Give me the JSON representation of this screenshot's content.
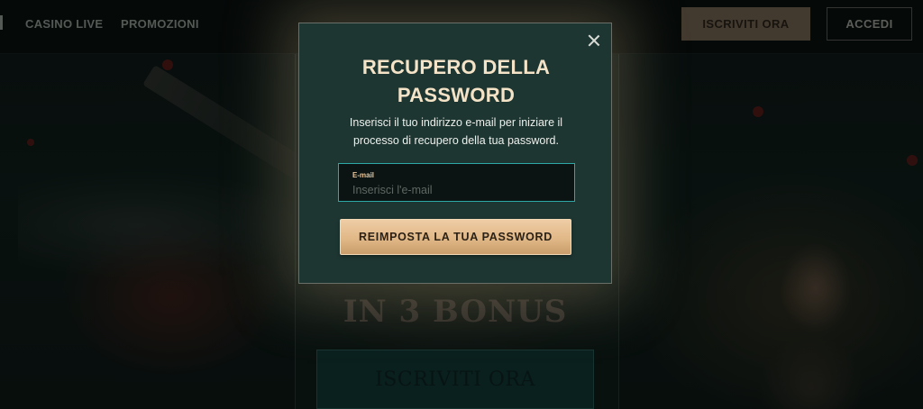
{
  "nav": {
    "links": [
      "CASINO LIVE",
      "PROMOZIONI"
    ],
    "signup_label": "ISCRIVITI ORA",
    "login_label": "ACCEDI"
  },
  "hero": {
    "title": "IN 3 BONUS",
    "cta_label": "ISCRIVITI ORA"
  },
  "modal": {
    "title": "RECUPERO DELLA PASSWORD",
    "description": "Inserisci il tuo indirizzo e-mail per iniziare il processo di recupero della tua password.",
    "email_label": "E-mail",
    "email_placeholder": "Inserisci l'e-mail",
    "email_value": "",
    "submit_label": "REIMPOSTA LA TUA PASSWORD",
    "close_icon": "close-icon"
  },
  "colors": {
    "modal_bg": "#1e3632",
    "accent_gold": "#e1b887",
    "input_border": "#2ea8a6",
    "title_text": "#f4e3c6"
  }
}
